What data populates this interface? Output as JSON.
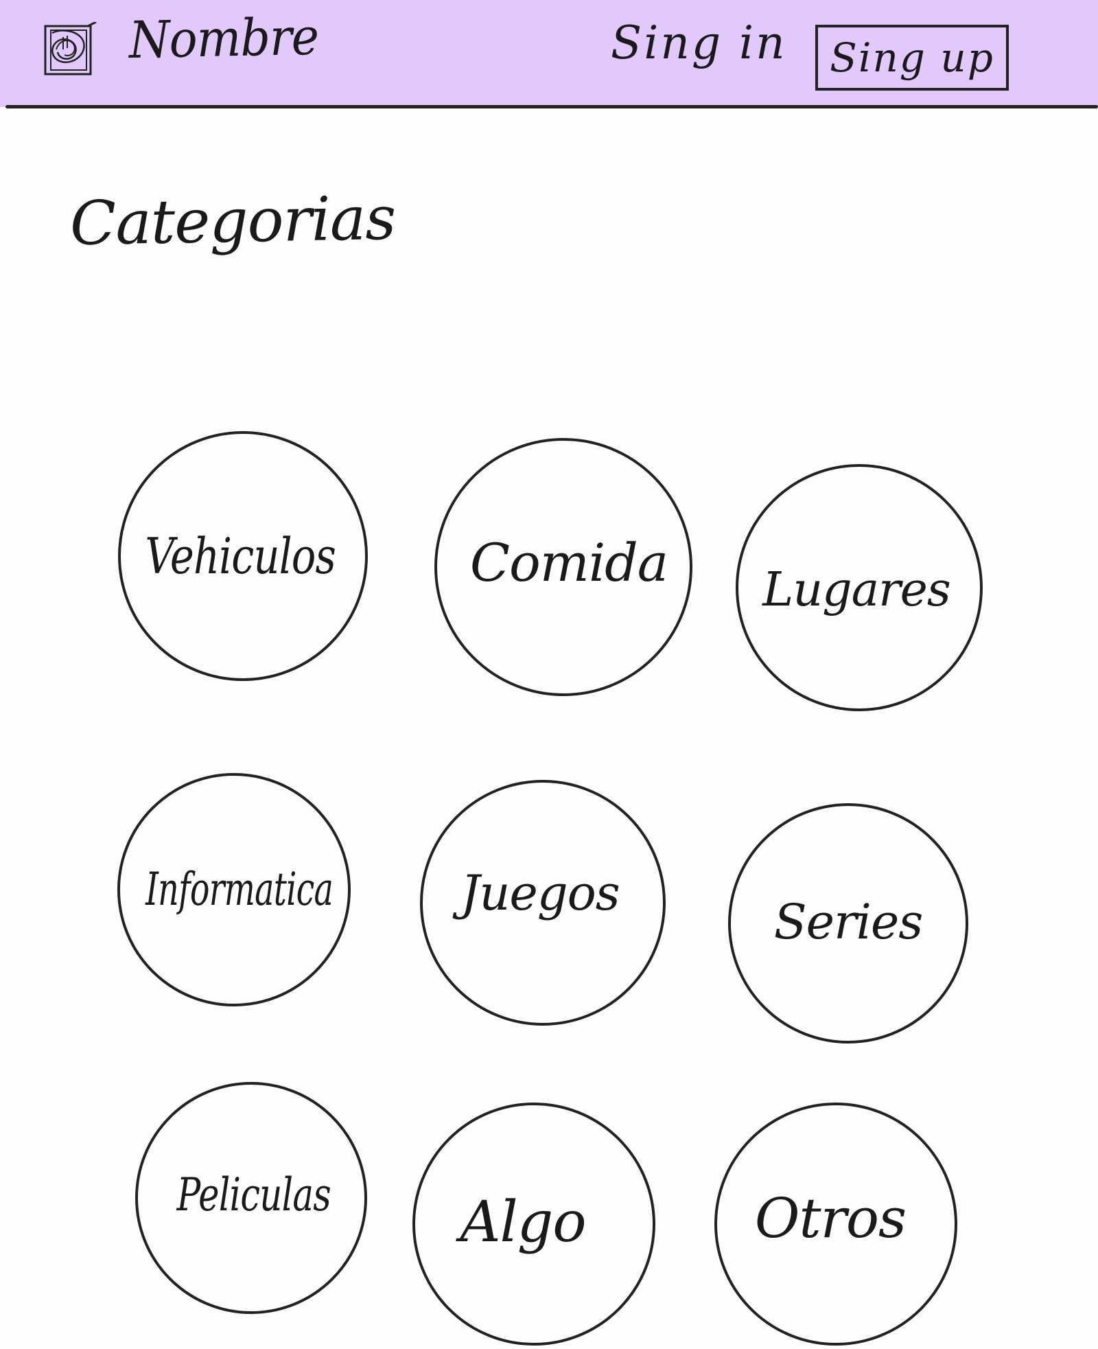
{
  "header": {
    "brand": "Nombre",
    "sign_in_label": "Sing in",
    "sign_up_label": "Sing up",
    "background_color": "#e2c9fb"
  },
  "main": {
    "title": "Categorias",
    "categories": [
      {
        "label": "Vehiculos"
      },
      {
        "label": "Comida"
      },
      {
        "label": "Lugares"
      },
      {
        "label": "Informatica"
      },
      {
        "label": "Juegos"
      },
      {
        "label": "Series"
      },
      {
        "label": "Peliculas"
      },
      {
        "label": "Algo"
      },
      {
        "label": "Otros"
      }
    ]
  }
}
